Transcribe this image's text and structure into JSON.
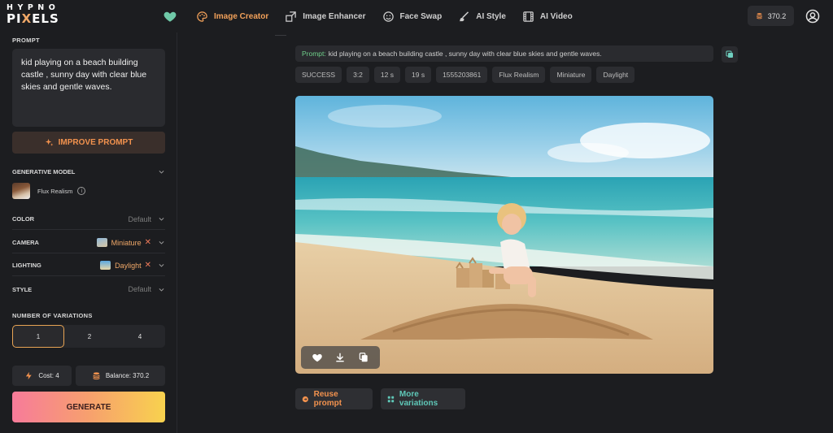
{
  "app": {
    "logo_line1": "HYPNO",
    "logo_line2_a": "PI",
    "logo_line2_x": "X",
    "logo_line2_b": "ELS"
  },
  "header": {
    "nav": [
      {
        "label": "Image Creator",
        "icon": "palette-icon",
        "active": true
      },
      {
        "label": "Image Enhancer",
        "icon": "expand-icon",
        "active": false
      },
      {
        "label": "Face Swap",
        "icon": "smiley-icon",
        "active": false
      },
      {
        "label": "AI Style",
        "icon": "brush-icon",
        "active": false
      },
      {
        "label": "AI Video",
        "icon": "film-icon",
        "active": false
      }
    ],
    "balance": "370.2"
  },
  "sidebar": {
    "prompt_label": "PROMPT",
    "prompt_text": "kid playing on a beach building castle , sunny day with clear blue skies and gentle waves.",
    "improve_label": "IMPROVE PROMPT",
    "model_label": "GENERATIVE MODEL",
    "model_name": "Flux Realism",
    "info_glyph": "i",
    "color_label": "COLOR",
    "color_value": "Default",
    "camera_label": "CAMERA",
    "camera_value": "Miniature",
    "lighting_label": "LIGHTING",
    "lighting_value": "Daylight",
    "style_label": "STYLE",
    "style_value": "Default",
    "remove_glyph": "✕",
    "variations_label": "NUMBER OF VARIATIONS",
    "variations": [
      "1",
      "2",
      "4"
    ],
    "selected_variation": "1",
    "cost": "Cost: 4",
    "balance": "Balance: 370.2",
    "generate_label": "GENERATE"
  },
  "result": {
    "prompt_prefix": "Prompt:",
    "prompt_text": "kid playing on a beach building castle , sunny day with clear blue skies and gentle waves.",
    "chips": [
      "SUCCESS",
      "3:2",
      "12 s",
      "19 s",
      "1555203861",
      "Flux Realism",
      "Miniature",
      "Daylight"
    ],
    "reuse_label": "Reuse prompt",
    "variations_label": "More variations"
  },
  "colors": {
    "accent_orange": "#f2a15a",
    "success_green": "#6fd08a",
    "reuse_orange": "#f2924e",
    "variations_teal": "#5fc8b8"
  }
}
